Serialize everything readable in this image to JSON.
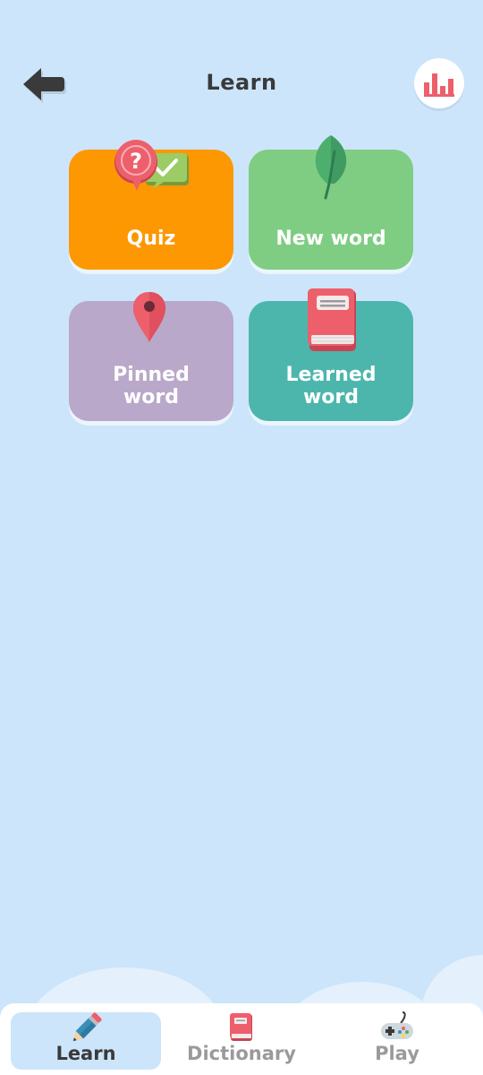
{
  "header": {
    "title": "Learn",
    "back_icon": "arrow-left-icon",
    "stats_icon": "bar-chart-icon"
  },
  "tiles": [
    {
      "label": "Quiz",
      "color": "#fd9702",
      "icon": "quiz-bubbles-icon"
    },
    {
      "label": "New word",
      "color": "#7fcd83",
      "icon": "leaf-icon"
    },
    {
      "label_line1": "Pinned",
      "label_line2": "word",
      "color": "#b9a8c9",
      "icon": "map-pin-icon"
    },
    {
      "label_line1": "Learned",
      "label_line2": "word",
      "color": "#4db6ac",
      "icon": "book-icon"
    }
  ],
  "bottom_nav": {
    "items": [
      {
        "label": "Learn",
        "icon": "pencil-icon",
        "active": true
      },
      {
        "label": "Dictionary",
        "icon": "book-icon",
        "active": false
      },
      {
        "label": "Play",
        "icon": "gamepad-icon",
        "active": false
      }
    ]
  },
  "colors": {
    "background": "#cce5fb",
    "accent_pink": "#ee5f6c"
  }
}
